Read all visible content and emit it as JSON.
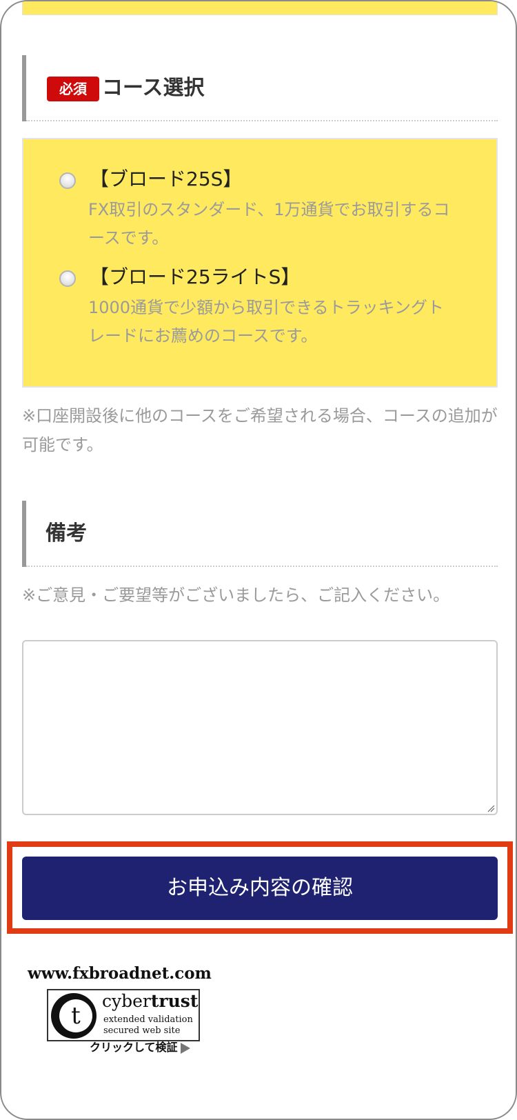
{
  "course_section": {
    "required_badge": "必須",
    "heading": "コース選択",
    "options": [
      {
        "title": "【ブロード25S】",
        "description": "FX取引のスタンダード、1万通貨でお取引するコースです。",
        "selected": false
      },
      {
        "title": "【ブロード25ライトS】",
        "description": "1000通貨で少額から取引できるトラッキングトレードにお薦めのコースです。",
        "selected": false
      }
    ],
    "note": "※口座開設後に他のコースをご希望される場合、コースの追加が可能です。"
  },
  "remarks_section": {
    "heading": "備考",
    "note": "※ご意見・ご要望等がございましたら、ご記入ください。",
    "textarea_value": ""
  },
  "confirm_button": {
    "label": "お申込み内容の確認"
  },
  "footer": {
    "site_url": "www.fxbroadnet.com",
    "seal": {
      "logo_letter": "t",
      "brand_light": "cyber",
      "brand_bold": "trust",
      "line1": "extended validation",
      "line2": "secured web site",
      "verify_label": "クリックして検証"
    }
  },
  "colors": {
    "yellow_panel": "#fee95f",
    "required_red": "#cf0a0a",
    "button_navy": "#1e2271",
    "highlight_orange": "#e13b13",
    "muted_text": "#9a9a9a"
  }
}
